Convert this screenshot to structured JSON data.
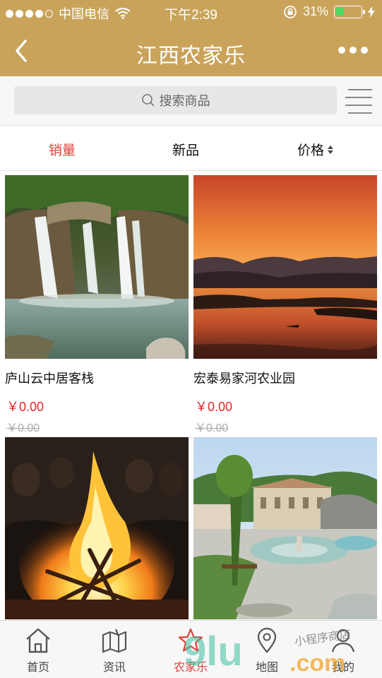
{
  "status": {
    "carrier": "中国电信",
    "time": "下午2:39",
    "battery": "31%",
    "battery_level": 0.31
  },
  "nav": {
    "title": "江西农家乐"
  },
  "search": {
    "placeholder": "搜索商品"
  },
  "sort": {
    "tabs": [
      "销量",
      "新品",
      "价格"
    ],
    "active": "销量"
  },
  "products": [
    {
      "name": "庐山云中居客栈",
      "price": "￥0.00",
      "original_price": "￥0.00"
    },
    {
      "name": "宏泰易家河农业园",
      "price": "￥0.00",
      "original_price": "￥0.00"
    },
    {
      "name": "",
      "price": "",
      "original_price": ""
    },
    {
      "name": "",
      "price": "",
      "original_price": ""
    }
  ],
  "tabbar": {
    "items": [
      "首页",
      "资讯",
      "农家乐",
      "地图",
      "我的"
    ],
    "active": "农家乐"
  },
  "watermark": {
    "text": "小程序商店",
    "brand": "9lu.com"
  },
  "colors": {
    "header": "#c9a35a",
    "accent": "#e0403a",
    "price": "#e0262a"
  }
}
